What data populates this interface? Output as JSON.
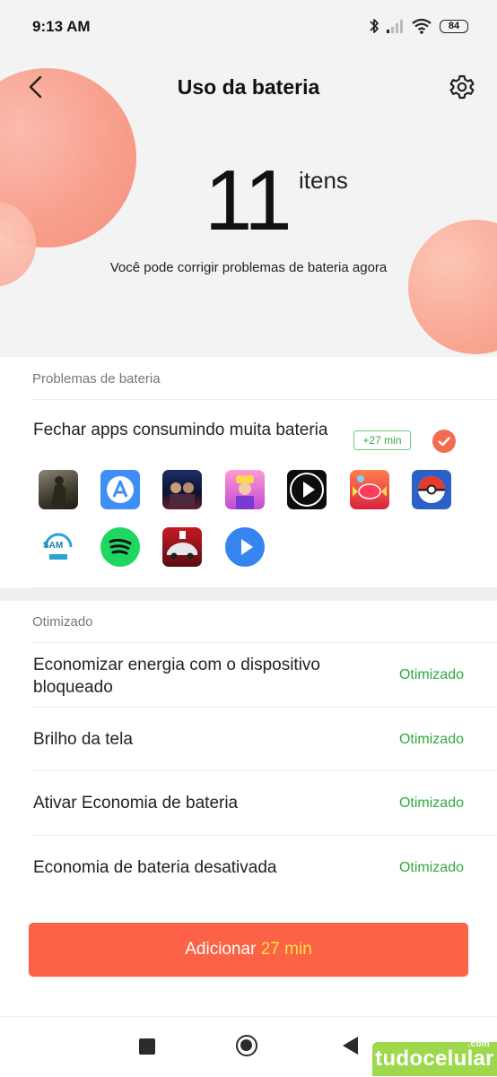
{
  "status_bar": {
    "time": "9:13 AM",
    "battery": "84"
  },
  "header": {
    "title": "Uso da bateria"
  },
  "summary": {
    "count": "11",
    "unit": "itens",
    "message": "Você pode corrigir problemas de bateria agora"
  },
  "problems": {
    "section_title": "Problemas de bateria",
    "item_title": "Fechar apps consumindo muita bateria",
    "gain": "+27 min",
    "apps": [
      {
        "name": "call-of-duty-app-icon"
      },
      {
        "name": "app-a-icon"
      },
      {
        "name": "marvel-game-app-icon"
      },
      {
        "name": "subway-surfers-app-icon"
      },
      {
        "name": "video-player-app-icon"
      },
      {
        "name": "candy-crush-app-icon"
      },
      {
        "name": "pokemon-go-app-icon"
      },
      {
        "name": "gsam-battery-monitor-app-icon",
        "label": "SAM"
      },
      {
        "name": "spotify-app-icon"
      },
      {
        "name": "asphalt-racing-app-icon"
      },
      {
        "name": "play-app-icon"
      }
    ]
  },
  "optimized": {
    "section_title": "Otimizado",
    "items": [
      {
        "label": "Economizar energia com o dispositivo bloqueado",
        "status": "Otimizado"
      },
      {
        "label": "Brilho da tela",
        "status": "Otimizado"
      },
      {
        "label": "Ativar Economia de bateria",
        "status": "Otimizado"
      },
      {
        "label": "Economia de bateria desativada",
        "status": "Otimizado"
      }
    ]
  },
  "action": {
    "label_prefix": "Adicionar ",
    "label_highlight": "27 min"
  },
  "watermark": {
    "text": "tudocelular",
    "suffix": ".com"
  },
  "colors": {
    "accent": "#fb6246",
    "success": "#2faa3d",
    "highlight": "#ffe14a"
  }
}
